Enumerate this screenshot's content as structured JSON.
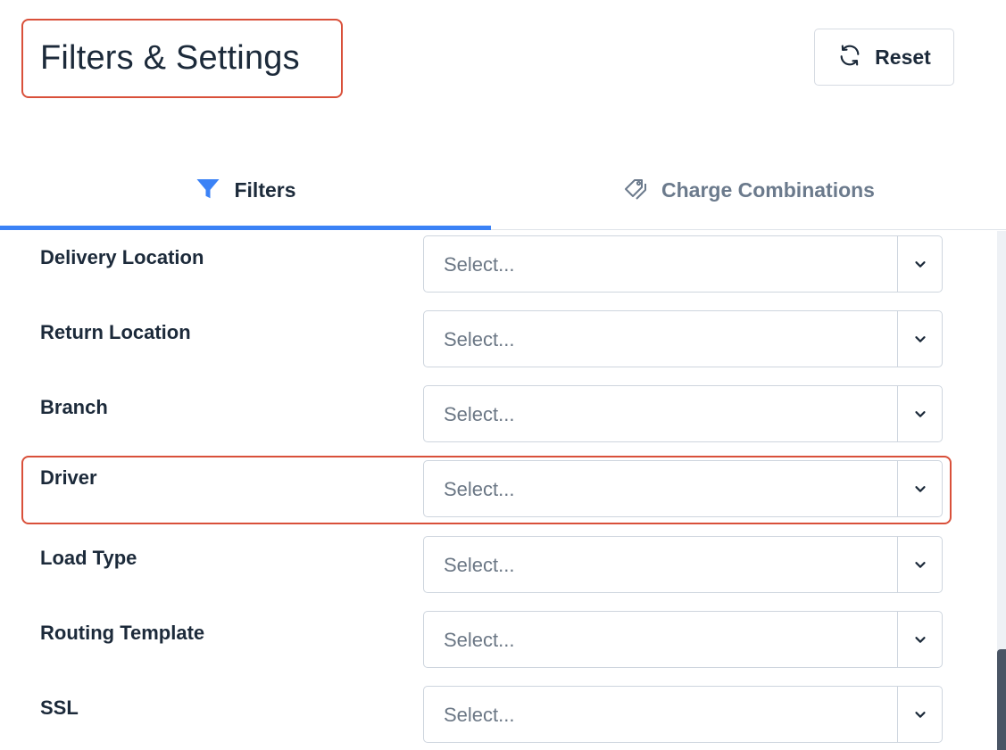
{
  "header": {
    "title": "Filters & Settings",
    "reset_label": "Reset"
  },
  "tabs": [
    {
      "label": "Filters",
      "icon": "filter-icon",
      "active": true
    },
    {
      "label": "Charge Combinations",
      "icon": "tags-icon",
      "active": false
    }
  ],
  "fields": [
    {
      "label": "Delivery Location",
      "placeholder": "Select..."
    },
    {
      "label": "Return Location",
      "placeholder": "Select..."
    },
    {
      "label": "Branch",
      "placeholder": "Select..."
    },
    {
      "label": "Driver",
      "placeholder": "Select...",
      "highlighted": true
    },
    {
      "label": "Load Type",
      "placeholder": "Select..."
    },
    {
      "label": "Routing Template",
      "placeholder": "Select..."
    },
    {
      "label": "SSL",
      "placeholder": "Select..."
    }
  ],
  "colors": {
    "accent": "#3b82f6",
    "highlight": "#d9503a",
    "text": "#1c2a3a",
    "muted": "#6b7a8c"
  }
}
